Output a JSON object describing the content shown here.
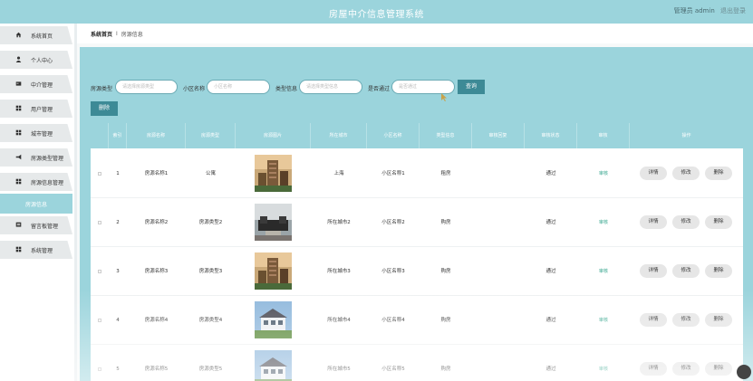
{
  "header": {
    "title": "房屋中介信息管理系统",
    "admin_label": "管理员 admin",
    "logout_label": "退出登录"
  },
  "sidebar": {
    "items": [
      {
        "label": "系统首页",
        "icon": "home-icon"
      },
      {
        "label": "个人中心",
        "icon": "user-icon"
      },
      {
        "label": "中介管理",
        "icon": "card-icon"
      },
      {
        "label": "用户管理",
        "icon": "grid-icon"
      },
      {
        "label": "城市管理",
        "icon": "grid-icon"
      },
      {
        "label": "房源类型管理",
        "icon": "tag-icon"
      },
      {
        "label": "房源信息管理",
        "icon": "grid-icon"
      },
      {
        "label": "留言板管理",
        "icon": "message-icon"
      },
      {
        "label": "系统管理",
        "icon": "grid-icon"
      }
    ],
    "active_sub": "房源信息"
  },
  "breadcrumb": {
    "home": "系统首页",
    "separator": "I",
    "current": "房源信息"
  },
  "filters": {
    "type_label": "房源类型",
    "type_placeholder": "请选择房源类型",
    "community_label": "小区名称",
    "community_placeholder": "小区名称",
    "type_info_label": "类型信息",
    "type_info_placeholder": "请选择类型信息",
    "pass_label": "是否通过",
    "pass_placeholder": "是否通过",
    "query_button": "查询"
  },
  "actions": {
    "delete_button": "删除"
  },
  "table": {
    "columns": [
      "",
      "索引",
      "房源名称",
      "房源类型",
      "房源图片",
      "所在城市",
      "小区名称",
      "类型信息",
      "审核回复",
      "审核状态",
      "审核",
      "操作"
    ],
    "rows": [
      {
        "index": "1",
        "name": "房源名称1",
        "type": "公寓",
        "image": "tower",
        "city": "上海",
        "community": "小区名称1",
        "info": "租房",
        "reply": "",
        "status": "通过",
        "audit": "审核"
      },
      {
        "index": "2",
        "name": "房源名称2",
        "type": "房源类型2",
        "image": "living-room",
        "city": "所在城市2",
        "community": "小区名称2",
        "info": "购房",
        "reply": "",
        "status": "通过",
        "audit": "审核"
      },
      {
        "index": "3",
        "name": "房源名称3",
        "type": "房源类型3",
        "image": "tower",
        "city": "所在城市3",
        "community": "小区名称3",
        "info": "购房",
        "reply": "",
        "status": "通过",
        "audit": "审核"
      },
      {
        "index": "4",
        "name": "房源名称4",
        "type": "房源类型4",
        "image": "villa",
        "city": "所在城市4",
        "community": "小区名称4",
        "info": "购房",
        "reply": "",
        "status": "通过",
        "audit": "审核"
      },
      {
        "index": "5",
        "name": "房源名称5",
        "type": "房源类型5",
        "image": "villa",
        "city": "所在城市5",
        "community": "小区名称5",
        "info": "购房",
        "reply": "",
        "status": "通过",
        "audit": "审核"
      }
    ],
    "op_labels": {
      "detail": "详情",
      "edit": "修改",
      "delete": "删除"
    }
  },
  "colors": {
    "accent": "#9bd4dc",
    "button": "#3d8a96",
    "audit_link": "#3aa890"
  }
}
